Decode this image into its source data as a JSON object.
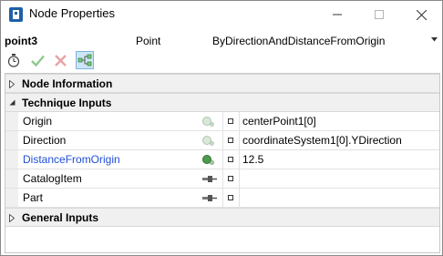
{
  "window": {
    "title": "Node Properties"
  },
  "node": {
    "name": "point3",
    "type": "Point",
    "technique": "ByDirectionAndDistanceFromOrigin"
  },
  "toolbar": {
    "icons": [
      "stopwatch-icon",
      "checkmark-icon",
      "cross-icon",
      "graph-icon"
    ]
  },
  "sections": {
    "node_information": "Node Information",
    "technique_inputs": "Technique Inputs",
    "general_inputs": "General Inputs"
  },
  "inputs": [
    {
      "name": "Origin",
      "value": "centerPoint1[0]",
      "icon": "connected-dot-icon"
    },
    {
      "name": "Direction",
      "value": "coordinateSystem1[0].YDirection",
      "icon": "connected-dot-icon"
    },
    {
      "name": "DistanceFromOrigin",
      "value": "12.5",
      "icon": "active-dot-icon"
    },
    {
      "name": "CatalogItem",
      "value": "",
      "icon": "plug-icon"
    },
    {
      "name": "Part",
      "value": "",
      "icon": "plug-icon"
    }
  ],
  "colors": {
    "highlight_name": "#1f4fd6",
    "section_bg": "#f0f0f0",
    "selected_toolbar": "#cde6f7"
  }
}
